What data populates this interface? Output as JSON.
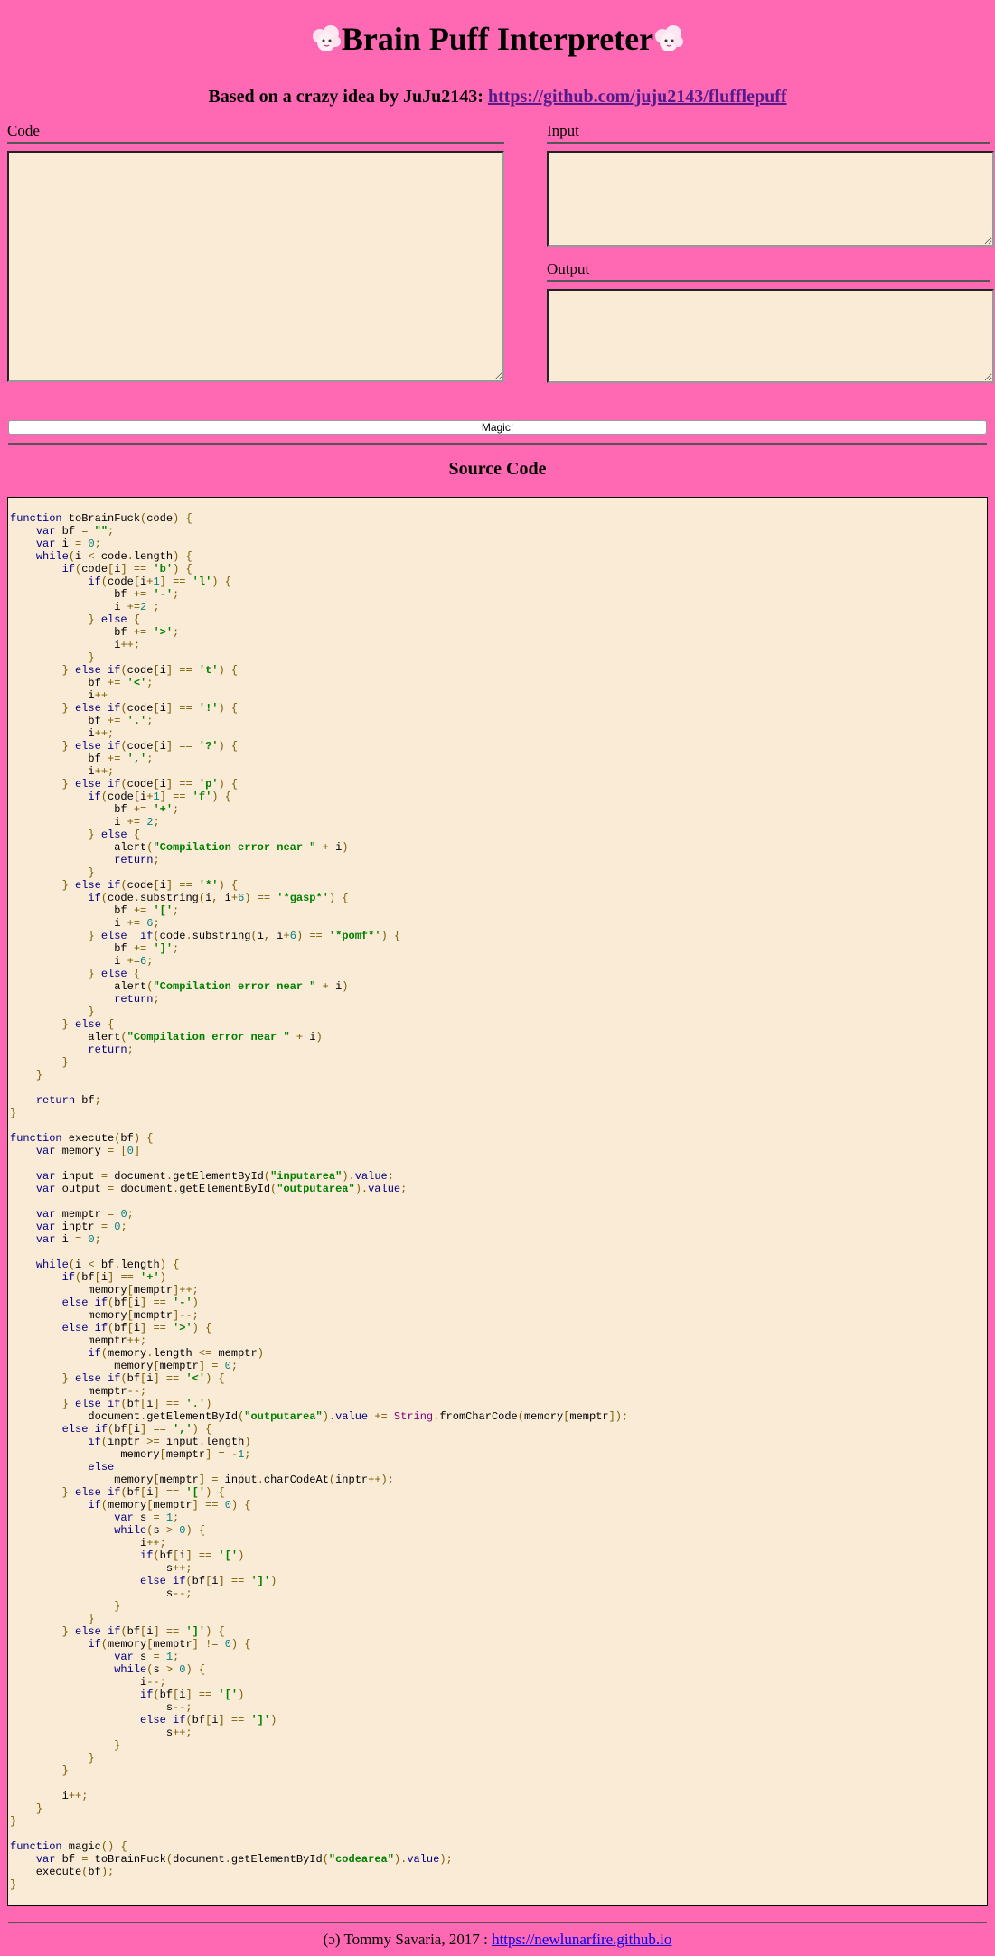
{
  "header": {
    "title": "Brain Puff Interpreter",
    "subtitle_prefix": "Based on a crazy idea by JuJu2143: ",
    "subtitle_link": "https://github.com/juju2143/flufflepuff"
  },
  "code_panel": {
    "label": "Code",
    "value": ""
  },
  "input_panel": {
    "label": "Input",
    "value": ""
  },
  "output_panel": {
    "label": "Output",
    "value": ""
  },
  "magic_button": {
    "label": "Magic!"
  },
  "source": {
    "title": "Source Code"
  },
  "footer": {
    "credit": "(ɔ) Tommy Savaria, 2017 : ",
    "link": "https://newlunarfire.github.io"
  },
  "colors": {
    "background": "#ff69b4",
    "textarea_bg": "#faebd7",
    "keyword": "#000080",
    "string": "#008000",
    "number": "#008080"
  }
}
